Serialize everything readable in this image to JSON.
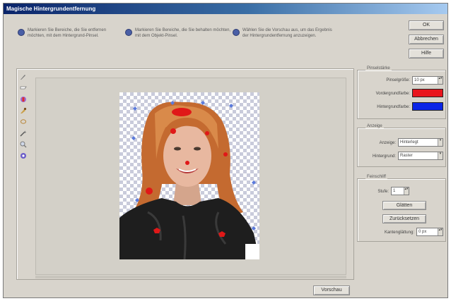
{
  "window": {
    "title": "Magische Hintergrundentfernung"
  },
  "instructions": [
    "Markieren Sie Bereiche, die Sie entfernen möchten, mit dem Hintergrund-Pinsel.",
    "Markieren Sie Bereiche, die Sie behalten möchten, mit dem Objekt-Pinsel.",
    "Wählen Sie die Vorschau aus, um das Ergebnis der Hintergrundentfernung anzuzeigen."
  ],
  "dialog_buttons": {
    "ok": "OK",
    "cancel": "Abbrechen",
    "help": "Hilfe"
  },
  "preview_button": "Vorschau",
  "settings": {
    "section_title": "Pinselstärke",
    "size_label": "Pinselgröße:",
    "size_value": "10 px",
    "foreground_label": "Vordergrundfarbe:",
    "background_label": "Hintergrundfarbe:",
    "foreground_color": "#e8141c",
    "background_color": "#0a24e6"
  },
  "display": {
    "section_title": "Anzeige",
    "display_label": "Anzeige:",
    "display_value": "Hinterlegt",
    "background_label": "Hintergrund:",
    "background_value": "Raster"
  },
  "refine": {
    "section_title": "Feinschliff",
    "level_label": "Stufe:",
    "level_value": "1",
    "btn1": "Glätten",
    "btn2": "Zurücksetzen",
    "edge_label": "Kantenglättung:",
    "edge_value": "0 px"
  },
  "tools": [
    "brush-fg-icon",
    "brush-bg-icon",
    "eraser-icon",
    "object-brush-icon",
    "lasso-icon",
    "magic-wand-icon",
    "zoom-icon",
    "hand-icon"
  ]
}
